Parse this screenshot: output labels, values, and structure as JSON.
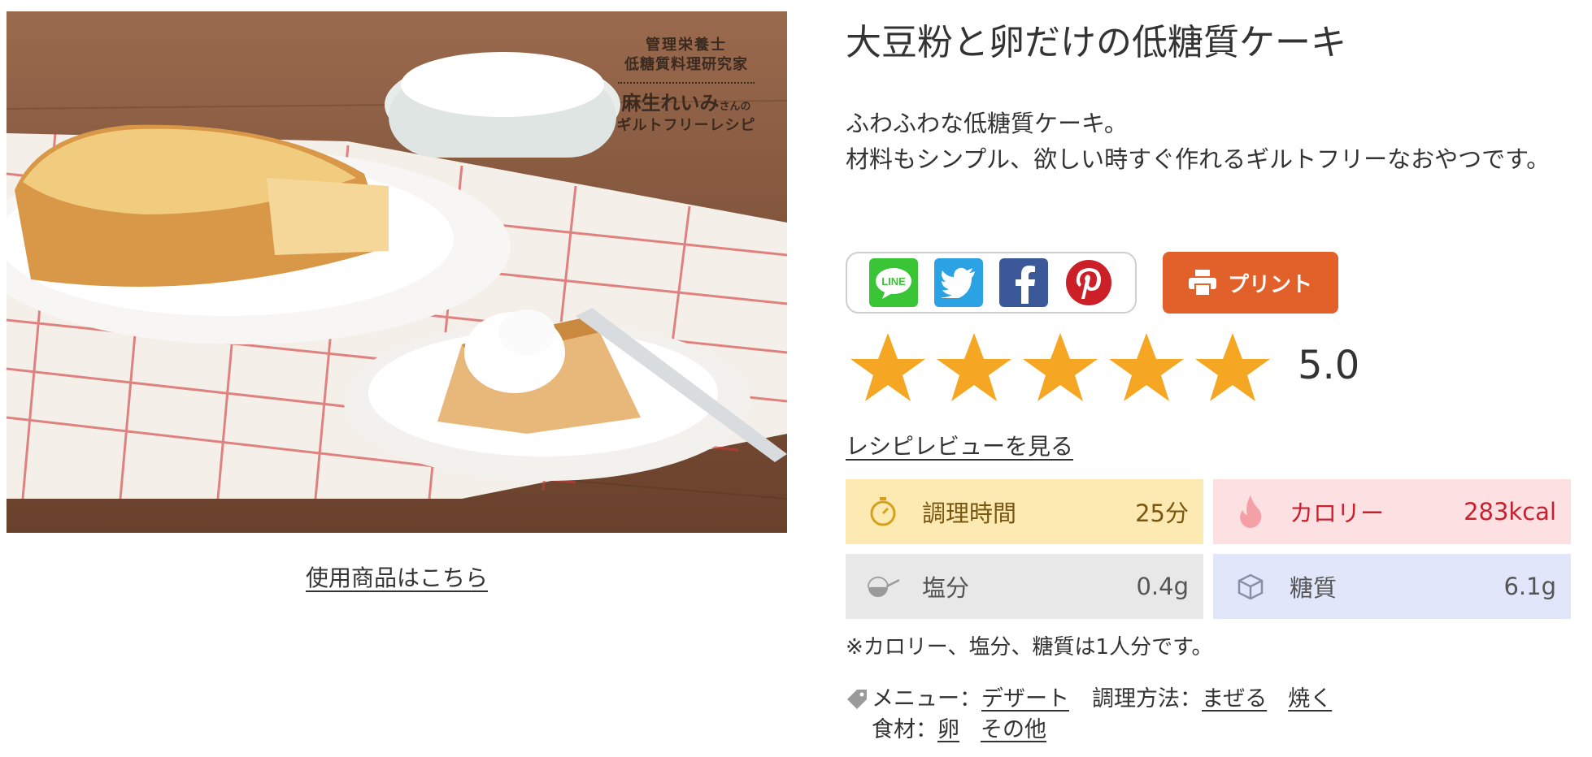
{
  "photo": {
    "badge": {
      "line1": "管理栄養士",
      "line2": "低糖質料理研究家",
      "name": "麻生れいみ",
      "name_suffix": "さんの",
      "line4": "ギルトフリーレシピ"
    }
  },
  "products_link": "使用商品はこちら",
  "recipe": {
    "title": "大豆粉と卵だけの低糖質ケーキ",
    "description_line1": "ふわふわな低糖質ケーキ。",
    "description_line2": "材料もシンプル、欲しい時すぐ作れるギルトフリーなおやつです。"
  },
  "share": {
    "line_label": "LINE",
    "icons": [
      "line-icon",
      "twitter-icon",
      "facebook-icon",
      "pinterest-icon"
    ]
  },
  "print_label": "プリント",
  "rating": {
    "value": "5.0",
    "stars": 5,
    "max": 5
  },
  "review_link": "レシピレビューを見る",
  "stats": {
    "time": {
      "label": "調理時間",
      "value": "25分",
      "icon": "timer-icon"
    },
    "calorie": {
      "label": "カロリー",
      "value": "283kcal",
      "icon": "flame-icon"
    },
    "salt": {
      "label": "塩分",
      "value": "0.4g",
      "icon": "salt-spoon-icon"
    },
    "sugar": {
      "label": "糖質",
      "value": "6.1g",
      "icon": "sugar-cube-icon"
    }
  },
  "note": "※カロリー、塩分、糖質は1人分です。",
  "tags": {
    "menu_label": "メニュー：",
    "menu_items": [
      "デザート"
    ],
    "method_label": "調理方法：",
    "method_items": [
      "まぜる",
      "焼く"
    ],
    "ingredient_label": "食材：",
    "ingredient_items": [
      "卵",
      "その他"
    ]
  },
  "colors": {
    "print": "#e2612a",
    "star": "#f5a623",
    "time_bg": "#fde9b2",
    "calorie_bg": "#fde0e2",
    "salt_bg": "#e8e8e8",
    "sugar_bg": "#e2e6fb"
  }
}
